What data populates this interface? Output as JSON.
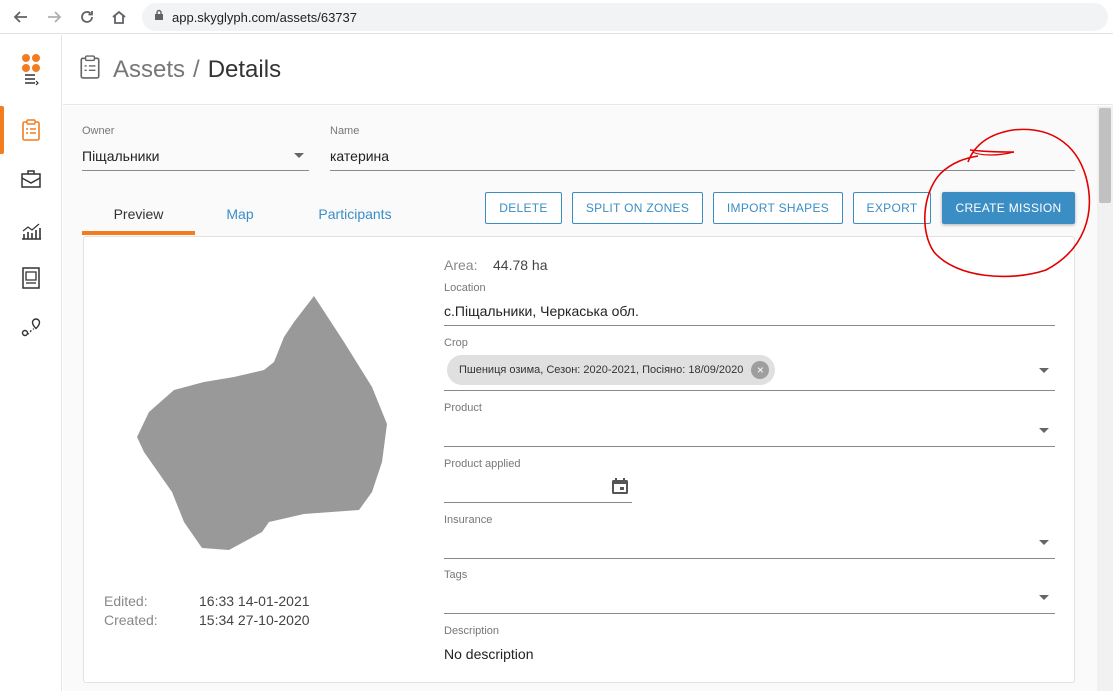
{
  "browser": {
    "url": "app.skyglyph.com/assets/63737"
  },
  "rail": {
    "items": [
      {
        "icon": "assets-clipboard-icon"
      },
      {
        "icon": "briefcase-icon"
      },
      {
        "icon": "analytics-chart-icon"
      },
      {
        "icon": "reports-document-icon"
      },
      {
        "icon": "route-icon"
      }
    ]
  },
  "header": {
    "section": "Assets",
    "separator": "/",
    "current": "Details"
  },
  "form": {
    "owner": {
      "label": "Owner",
      "value": "Піщальники"
    },
    "name": {
      "label": "Name",
      "value": "катерина"
    }
  },
  "tabs": [
    "Preview",
    "Map",
    "Participants"
  ],
  "actions": {
    "delete": "DELETE",
    "split": "SPLIT ON ZONES",
    "import": "IMPORT SHAPES",
    "export": "EXPORT",
    "create": "CREATE MISSION"
  },
  "details": {
    "area_label": "Area:",
    "area_value": "44.78 ha",
    "location_label": "Location",
    "location_value": "с.Піщальники, Черкаська обл.",
    "crop_label": "Crop",
    "crop_chip": "Пшениця озима, Сезон: 2020-2021, Посіяно: 18/09/2020",
    "product_label": "Product",
    "product_applied_label": "Product applied",
    "insurance_label": "Insurance",
    "tags_label": "Tags",
    "description_label": "Description",
    "description_value": "No description"
  },
  "meta": {
    "edited_label": "Edited:",
    "edited_value": "16:33 14-01-2021",
    "created_label": "Created:",
    "created_value": "15:34 27-10-2020"
  },
  "colors": {
    "accent_orange": "#f47c20",
    "primary_blue": "#3a8ec4",
    "annotation_red": "#e00000",
    "shape_gray": "#999999"
  }
}
